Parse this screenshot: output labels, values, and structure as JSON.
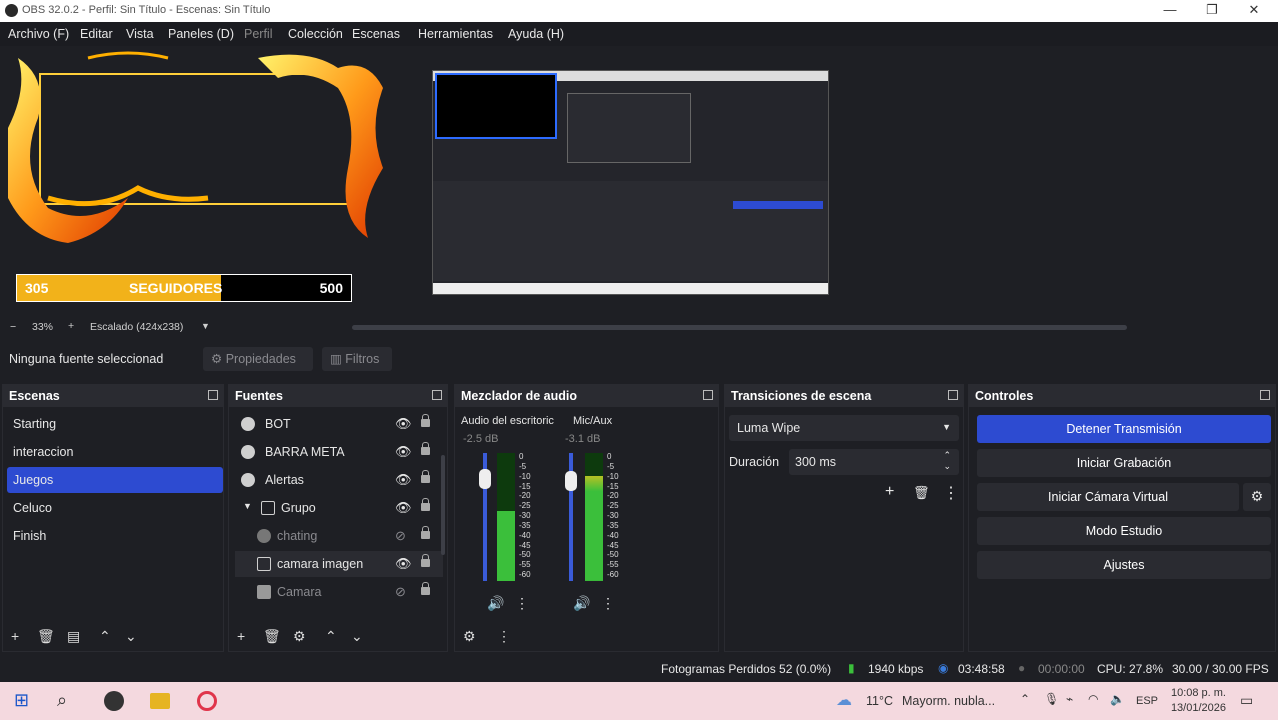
{
  "window": {
    "title": "OBS 32.0.2 - Perfil: Sin Título - Escenas: Sin Título"
  },
  "menu": [
    "Archivo (F)",
    "Editar",
    "Vista",
    "Paneles (D)",
    "Perfil",
    "Colección",
    "Escenas",
    "Herramientas",
    "Ayuda (H)"
  ],
  "preview": {
    "goal_current": "305",
    "goal_label": "SEGUIDORES",
    "goal_target": "500",
    "goal_fraction": 0.61
  },
  "zoom": {
    "minus": "−",
    "level": "33%",
    "plus": "+",
    "scaling": "Escalado (424x238)"
  },
  "source_bar": {
    "status": "Ninguna fuente seleccionad",
    "properties": "Propiedades",
    "filters": "Filtros"
  },
  "scenes": {
    "title": "Escenas",
    "items": [
      "Starting",
      "interaccion",
      "Juegos",
      "Celuco",
      "Finish"
    ],
    "active_index": 2
  },
  "sources": {
    "title": "Fuentes",
    "items": [
      {
        "name": "BOT",
        "icon": "browser-icon",
        "visible": true
      },
      {
        "name": "BARRA META",
        "icon": "browser-icon",
        "visible": true
      },
      {
        "name": "Alertas",
        "icon": "browser-icon",
        "visible": true
      },
      {
        "name": "Grupo",
        "icon": "folder-icon",
        "visible": true
      },
      {
        "name": "chating",
        "icon": "browser-icon",
        "visible": false
      },
      {
        "name": "camara imagen",
        "icon": "image-icon",
        "visible": true
      },
      {
        "name": "Camara",
        "icon": "camera-icon",
        "visible": false
      }
    ]
  },
  "mixer": {
    "title": "Mezclador de audio",
    "channels": [
      {
        "name": "Audio del escritoric",
        "db": "-2.5 dB",
        "level": 0.55
      },
      {
        "name": "Mic/Aux",
        "db": "-3.1 dB",
        "level": 0.82
      }
    ],
    "scale": [
      "0",
      "-5",
      "-10",
      "-15",
      "-20",
      "-25",
      "-30",
      "-35",
      "-40",
      "-45",
      "-50",
      "-55",
      "-60"
    ]
  },
  "transitions": {
    "title": "Transiciones de escena",
    "selected": "Luma Wipe",
    "duration_label": "Duración",
    "duration_value": "300 ms"
  },
  "controls": {
    "title": "Controles",
    "buttons": [
      "Detener Transmisión",
      "Iniciar Grabación",
      "Iniciar Cámara Virtual",
      "Modo Estudio",
      "Ajustes"
    ]
  },
  "status": {
    "dropped": "Fotogramas Perdidos 52 (0.0%)",
    "bitrate": "1940 kbps",
    "stream_time": "03:48:58",
    "record_time": "00:00:00",
    "cpu": "CPU: 27.8%",
    "fps": "30.00 / 30.00 FPS"
  },
  "taskbar": {
    "weather": "11°C",
    "weather_desc": "Mayorm. nubla...",
    "lang": "ESP",
    "time": "10:08 p. m.",
    "date": "13/01/2026"
  },
  "colors": {
    "accent": "#2d4bd1",
    "goal": "#f2b21a",
    "meter_green": "#3bbf3b",
    "meter_red": "#c62828"
  }
}
